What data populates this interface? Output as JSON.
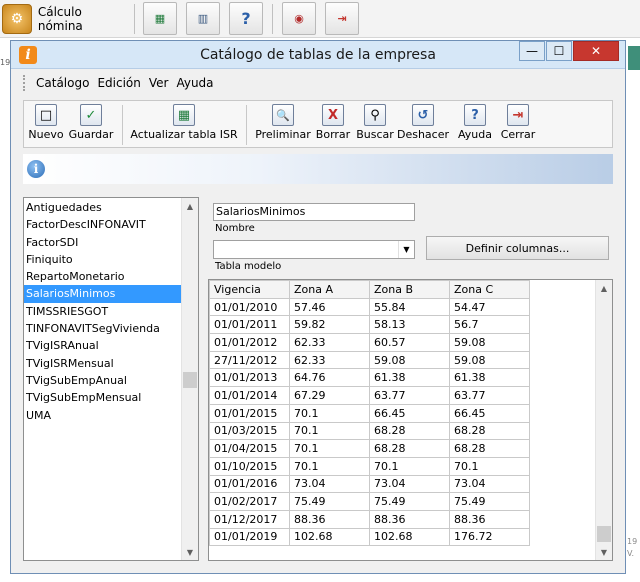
{
  "app_toolbar": {
    "title": "Cálculo nómina",
    "buttons": [
      {
        "icon": "excel-icon"
      },
      {
        "icon": "panel-icon"
      },
      {
        "icon": "help-icon",
        "glyph": "?"
      },
      {
        "icon": "imss-icon"
      },
      {
        "icon": "exit-icon"
      }
    ]
  },
  "window": {
    "title": "Catálogo de tablas de la empresa",
    "title_icon_glyph": "i",
    "minimize_glyph": "—",
    "maximize_glyph": "☐",
    "close_glyph": "✕"
  },
  "menu": {
    "items": [
      {
        "label": "Catálogo"
      },
      {
        "label": "Edición"
      },
      {
        "label": "Ver"
      },
      {
        "label": "Ayuda"
      }
    ]
  },
  "toolbar": {
    "buttons": [
      {
        "label": "Nuevo",
        "icon": "new-document-icon",
        "glyph": "□"
      },
      {
        "label": "Guardar",
        "icon": "save-check-icon",
        "glyph": "✓"
      },
      {
        "label": "Actualizar tabla ISR",
        "icon": "update-table-icon",
        "glyph": "▦"
      },
      {
        "label": "Preliminar",
        "icon": "preview-icon",
        "glyph": "🔍"
      },
      {
        "label": "Borrar",
        "icon": "delete-icon",
        "glyph": "X"
      },
      {
        "label": "Buscar",
        "icon": "binoculars-icon",
        "glyph": "⚲"
      },
      {
        "label": "Deshacer",
        "icon": "undo-icon",
        "glyph": "↺"
      },
      {
        "label": "Ayuda",
        "icon": "help-icon",
        "glyph": "?"
      },
      {
        "label": "Cerrar",
        "icon": "close-door-icon",
        "glyph": "⇥"
      }
    ]
  },
  "info": {
    "icon": "info-icon",
    "glyph": "i"
  },
  "tables_list": {
    "items": [
      "Antiguedades",
      "FactorDescINFONAVIT",
      "FactorSDI",
      "Finiquito",
      "RepartoMonetario",
      "SalariosMinimos",
      "TIMSSRIESGOT",
      "TINFONAVITSegVivienda",
      "TVigISRAnual",
      "TVigISRMensual",
      "TVigSubEmpAnual",
      "TVigSubEmpMensual",
      "UMA"
    ],
    "selected": "SalariosMinimos"
  },
  "form": {
    "name_value": "SalariosMinimos",
    "name_label": "Nombre",
    "model_value": "",
    "model_label": "Tabla modelo",
    "define_columns_label": "Definir columnas..."
  },
  "grid": {
    "headers": [
      "Vigencia",
      "Zona  A",
      "Zona  B",
      "Zona  C"
    ],
    "rows": [
      [
        "01/01/2010",
        "57.46",
        "55.84",
        "54.47"
      ],
      [
        "01/01/2011",
        "59.82",
        "58.13",
        "56.7"
      ],
      [
        "01/01/2012",
        "62.33",
        "60.57",
        "59.08"
      ],
      [
        "27/11/2012",
        "62.33",
        "59.08",
        "59.08"
      ],
      [
        "01/01/2013",
        "64.76",
        "61.38",
        "61.38"
      ],
      [
        "01/01/2014",
        "67.29",
        "63.77",
        "63.77"
      ],
      [
        "01/01/2015",
        "70.1",
        "66.45",
        "66.45"
      ],
      [
        "01/03/2015",
        "70.1",
        "68.28",
        "68.28"
      ],
      [
        "01/04/2015",
        "70.1",
        "68.28",
        "68.28"
      ],
      [
        "01/10/2015",
        "70.1",
        "70.1",
        "70.1"
      ],
      [
        "01/01/2016",
        "73.04",
        "73.04",
        "73.04"
      ],
      [
        "01/02/2017",
        "75.49",
        "75.49",
        "75.49"
      ],
      [
        "01/12/2017",
        "88.36",
        "88.36",
        "88.36"
      ],
      [
        "01/01/2019",
        "102.68",
        "102.68",
        "176.72"
      ]
    ]
  },
  "edge": {
    "left_text": "19",
    "right_text_1": "19",
    "right_text_2": "V."
  }
}
